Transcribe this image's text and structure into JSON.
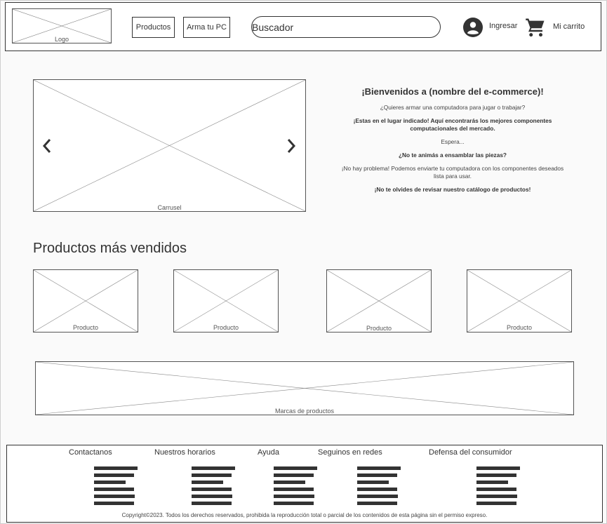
{
  "header": {
    "logo_label": "Logo",
    "nav": [
      "Productos",
      "Arma tu PC"
    ],
    "search_placeholder": "Buscador",
    "login_label": "Ingresar",
    "cart_label": "Mi carrito"
  },
  "hero": {
    "carousel_label": "Carrusel",
    "welcome": {
      "title": "¡Bienvenidos a (nombre del e-commerce)!",
      "line1": "¿Quieres armar una computadora para jugar o trabajar?",
      "line2": "¡Estas en el lugar indicado! Aquí encontrarás los mejores componentes computacionales del mercado.",
      "line3": "Espera...",
      "line4": "¿No te animás a ensamblar las piezas?",
      "line5": "¡No hay problema! Podemos enviarte tu computadora con los componentes deseados lista para usar.",
      "line6": "¡No te olvides de revisar nuestro catálogo de productos!"
    }
  },
  "best_sellers": {
    "title": "Productos más vendidos",
    "items": [
      "Producto",
      "Producto",
      "Producto",
      "Producto"
    ]
  },
  "brands_label": "Marcas de productos",
  "footer": {
    "columns": [
      "Contactanos",
      "Nuestros horarios",
      "Ayuda",
      "Seguinos en redes",
      "Defensa del consumidor"
    ],
    "copyright": "Copyright©2023. Todos los derechos reservados, prohibida la reproducción total o parcial de los contenidos de esta página sin el permiso expreso."
  }
}
